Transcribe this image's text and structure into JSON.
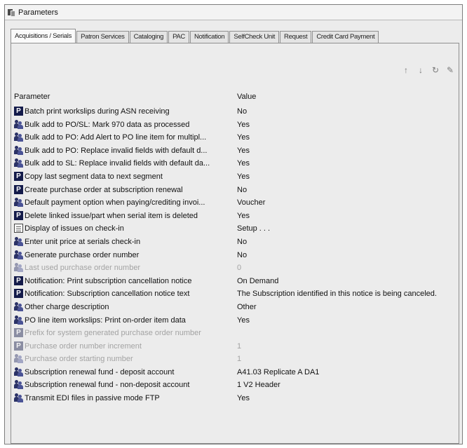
{
  "window": {
    "title": "Parameters"
  },
  "tabs": [
    {
      "label": "Acquisitions / Serials",
      "active": true
    },
    {
      "label": "Patron Services"
    },
    {
      "label": "Cataloging"
    },
    {
      "label": "PAC"
    },
    {
      "label": "Notification"
    },
    {
      "label": "SelfCheck Unit"
    },
    {
      "label": "Request"
    },
    {
      "label": "Credit Card Payment"
    }
  ],
  "toolbar": {
    "icons": [
      "arrow-up-icon",
      "arrow-down-icon",
      "refresh-icon",
      "edit-icon"
    ]
  },
  "table": {
    "headers": {
      "parameter": "Parameter",
      "value": "Value"
    },
    "rows": [
      {
        "icon": "p",
        "name": "Batch print workslips during ASN receiving",
        "value": "No"
      },
      {
        "icon": "s",
        "name": "Bulk add to PO/SL: Mark 970 data as processed",
        "value": "Yes"
      },
      {
        "icon": "s",
        "name": "Bulk add to PO: Add Alert to PO line item for multipl...",
        "value": "Yes"
      },
      {
        "icon": "s",
        "name": "Bulk add to PO: Replace invalid fields with default d...",
        "value": "Yes"
      },
      {
        "icon": "s",
        "name": "Bulk add to SL: Replace invalid fields with default da...",
        "value": "Yes"
      },
      {
        "icon": "p",
        "name": "Copy last segment data to next segment",
        "value": "Yes"
      },
      {
        "icon": "p",
        "name": "Create purchase order at subscription renewal",
        "value": "No"
      },
      {
        "icon": "s",
        "name": "Default payment option when paying/crediting invoi...",
        "value": "Voucher"
      },
      {
        "icon": "p",
        "name": "Delete linked issue/part when serial item is deleted",
        "value": "Yes"
      },
      {
        "icon": "g",
        "name": "Display of issues on check-in",
        "value": "Setup . . ."
      },
      {
        "icon": "s",
        "name": "Enter unit price at serials check-in",
        "value": "No"
      },
      {
        "icon": "s",
        "name": "Generate purchase order number",
        "value": "No"
      },
      {
        "icon": "s",
        "name": "Last used purchase order number",
        "value": "0",
        "disabled": true
      },
      {
        "icon": "p",
        "name": "Notification: Print subscription cancellation notice",
        "value": "On Demand"
      },
      {
        "icon": "p",
        "name": "Notification: Subscription cancellation notice text",
        "value": "The Subscription identified in this notice is being canceled."
      },
      {
        "icon": "s",
        "name": "Other charge description",
        "value": "Other"
      },
      {
        "icon": "s",
        "name": "PO line item workslips: Print on-order item data",
        "value": "Yes"
      },
      {
        "icon": "p",
        "name": "Prefix for system generated purchase order number",
        "value": "",
        "disabled": true
      },
      {
        "icon": "p",
        "name": "Purchase order number increment",
        "value": "1",
        "disabled": true
      },
      {
        "icon": "s",
        "name": "Purchase order starting number",
        "value": "1",
        "disabled": true
      },
      {
        "icon": "s",
        "name": "Subscription renewal fund - deposit account",
        "value": "A41.03 Replicate A DA1"
      },
      {
        "icon": "s",
        "name": "Subscription renewal fund - non-deposit account",
        "value": "1 V2 Header"
      },
      {
        "icon": "s",
        "name": "Transmit EDI files in passive mode FTP",
        "value": "Yes"
      }
    ]
  }
}
